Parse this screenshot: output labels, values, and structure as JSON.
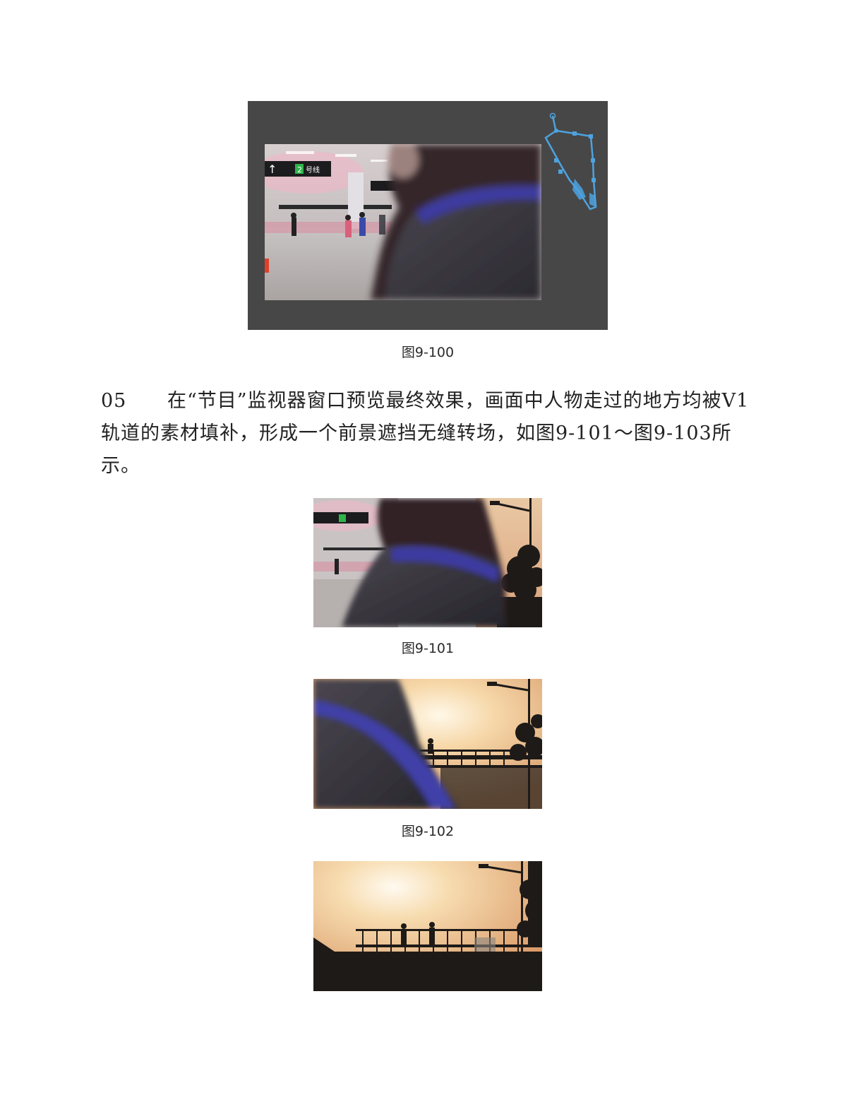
{
  "figures": {
    "fig100": {
      "caption": "图9-100"
    },
    "fig101": {
      "caption": "图9-101"
    },
    "fig102": {
      "caption": "图9-102"
    }
  },
  "step": {
    "number": "05",
    "text": "在“节目”监视器窗口预览最终效果，画面中人物走过的地方均被V1轨道的素材填补，形成一个前景遮挡无缝转场，如图9-101～图9-103所示。"
  },
  "signs": {
    "exit_arrow": "↑",
    "platform_number": "2",
    "line_label": "号线"
  },
  "colors": {
    "panel_bg": "#474747",
    "mask_path": "#4da3e0",
    "sunset_sky": "#f2c9a0",
    "silhouette": "#1e1a18",
    "jacket": "#3a3840",
    "strap": "#4a4aa8"
  }
}
